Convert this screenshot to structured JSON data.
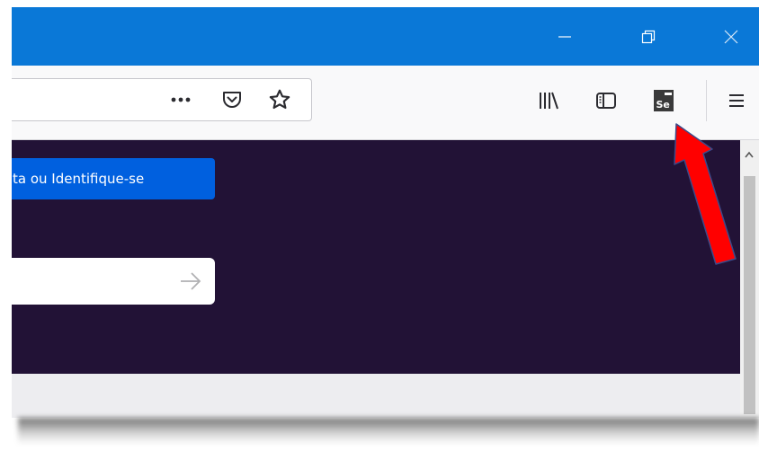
{
  "window": {
    "titlebar": {
      "minimize_icon": "minimize-icon",
      "restore_icon": "restore-icon",
      "close_icon": "close-icon"
    },
    "toolbar": {
      "urlbar": {
        "page_actions_icon": "more-icon",
        "pocket_icon": "pocket-icon",
        "bookmark_icon": "star-icon"
      },
      "library_icon": "library-icon",
      "sidebar_icon": "sidebar-icon",
      "selenium_ide_icon": "selenium-ide-icon",
      "selenium_ide_text": "Se",
      "menu_icon": "hamburger-menu-icon"
    },
    "content": {
      "login_button_label": "ta ou Identifique-se",
      "search_submit_icon": "arrow-right-icon"
    }
  },
  "annotation": {
    "arrow_color": "#ff0000",
    "arrow_outline": "#3b4b8a"
  },
  "colors": {
    "titlebar": "#0a78d7",
    "content_bg": "#221236",
    "login_button": "#0060df"
  }
}
